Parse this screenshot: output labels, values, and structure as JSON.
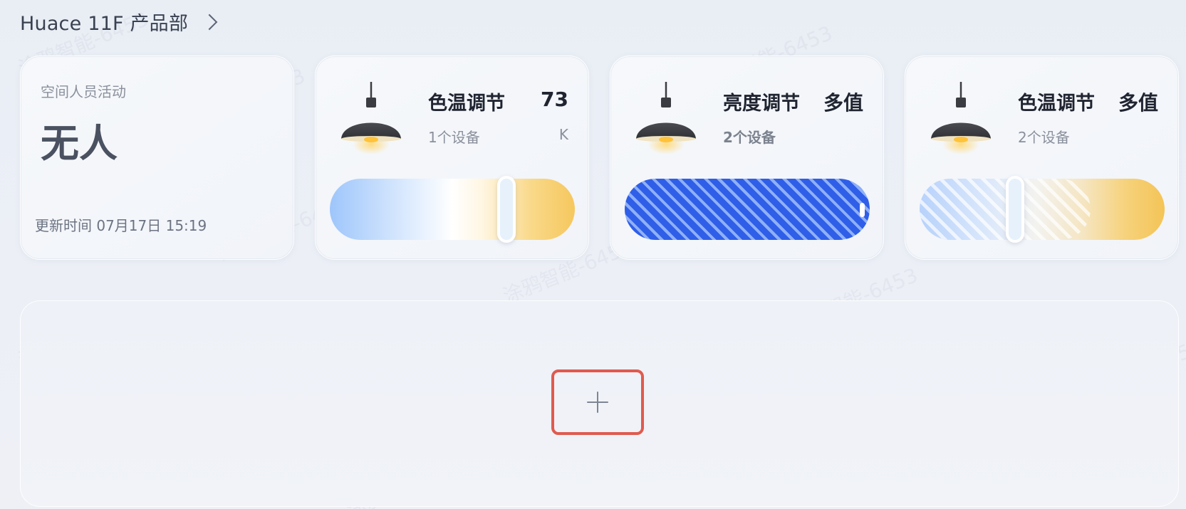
{
  "header": {
    "title": "Huace 11F 产品部"
  },
  "watermark": "涂鸦智能-6453",
  "occupancy": {
    "label": "空间人员活动",
    "value": "无人",
    "updated": "更新时间 07月17日 15:19"
  },
  "controls": [
    {
      "title": "色温调节",
      "value": "73",
      "devices": "1个设备",
      "unit": "K",
      "slider_level": 0.72
    },
    {
      "title": "亮度调节",
      "value": "多值",
      "devices": "2个设备",
      "unit": ""
    },
    {
      "title": "色温调节",
      "value": "多值",
      "devices": "2个设备",
      "unit": "",
      "slider_level": 0.39
    }
  ],
  "colors": {
    "accent_red": "#e05a4e",
    "brightness_blue": "#2f5fe8",
    "warm_yellow": "#f6c75d",
    "cool_blue": "#9ec6fb"
  },
  "icons": [
    "chevron-right-icon",
    "pendant-lamp-icon",
    "plus-icon"
  ]
}
